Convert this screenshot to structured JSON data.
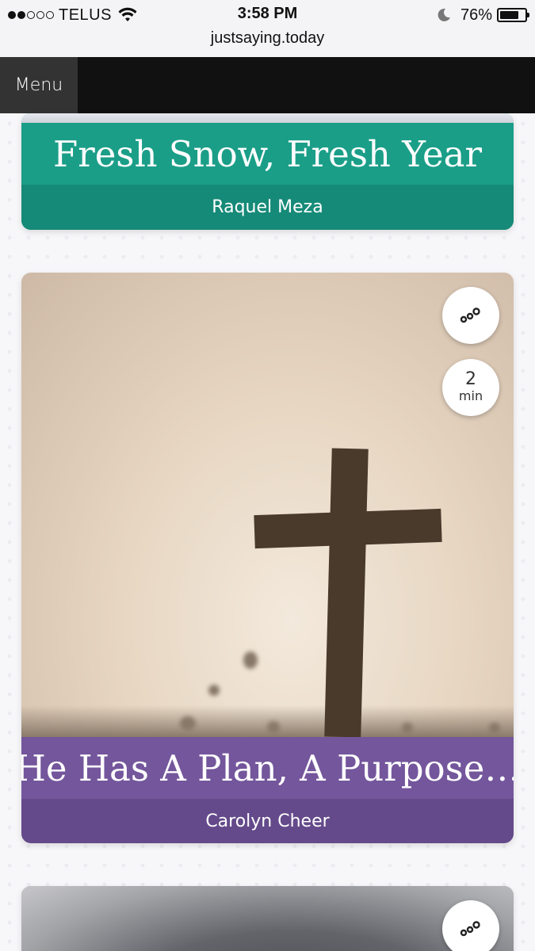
{
  "status_bar": {
    "carrier": "TELUS",
    "time": "3:58 PM",
    "battery": "76%",
    "battery_level": 0.76,
    "url": "justsaying.today"
  },
  "nav": {
    "menu_label": "Menu"
  },
  "cards": [
    {
      "title": "Fresh Snow, Fresh Year",
      "author": "Raquel Meza",
      "color": "#1b9e88"
    },
    {
      "title": "He Has A Plan, A Purpose…",
      "author": "Carolyn Cheer",
      "duration_value": "2",
      "duration_unit": "min",
      "color": "#74569c"
    },
    {
      "color": "#7d7f84"
    }
  ]
}
